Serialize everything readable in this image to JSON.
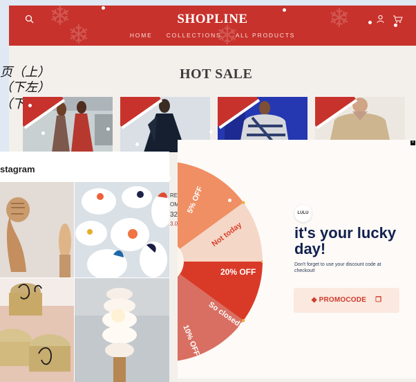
{
  "header": {
    "brand": "SHOPLINE",
    "nav": [
      "HOME",
      "COLLECTIONS",
      "ALL PRODUCTS"
    ]
  },
  "side_text": [
    "页（上）",
    "（下左）",
    "（下右）"
  ],
  "section_title": "HOT SALE",
  "instagram_title": "stagram",
  "obscured_product_text": [
    "RE",
    "OM",
    "32",
    "3.0"
  ],
  "popup": {
    "brand_badge": "LULU",
    "title": "it's your lucky day!",
    "body": "Don't forget to use your discount code at checkout!",
    "promo_code": "PROMOCODE"
  },
  "wheel_labels": [
    "5% OFF",
    "Not today",
    "20% OFF",
    "So closed!",
    "10% OFF"
  ],
  "colors": {
    "header": "#c8322c",
    "wheel_light": "#ef8f63",
    "wheel_pale": "#f5d7c7",
    "wheel_dark": "#d93a27",
    "wheel_rose": "#d86f62",
    "wheel_orange": "#e3653b",
    "navy": "#11214f"
  }
}
